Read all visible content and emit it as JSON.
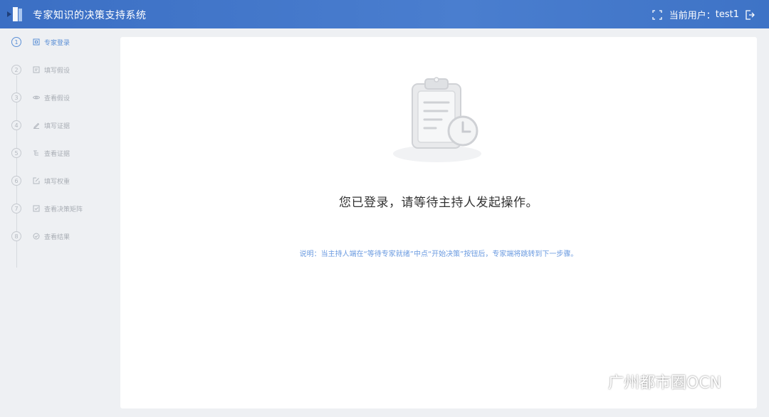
{
  "header": {
    "title": "专家知识的决策支持系统",
    "user_label": "当前用户：",
    "user_name": "test1"
  },
  "steps": [
    {
      "num": "1",
      "label": "专家登录",
      "icon": "login-icon",
      "active": true
    },
    {
      "num": "2",
      "label": "填写假设",
      "icon": "form-icon",
      "active": false
    },
    {
      "num": "3",
      "label": "查看假设",
      "icon": "eye-icon",
      "active": false
    },
    {
      "num": "4",
      "label": "填写证据",
      "icon": "pen-icon",
      "active": false
    },
    {
      "num": "5",
      "label": "查看证据",
      "icon": "list-icon",
      "active": false
    },
    {
      "num": "6",
      "label": "填写权重",
      "icon": "edit-icon",
      "active": false
    },
    {
      "num": "7",
      "label": "查看决策矩阵",
      "icon": "matrix-icon",
      "active": false
    },
    {
      "num": "8",
      "label": "查看结果",
      "icon": "check-circle-icon",
      "active": false
    }
  ],
  "main": {
    "message": "您已登录，请等待主持人发起操作。",
    "note": "说明：当主持人端在“等待专家就绪”中点“开始决策”按钮后，专家端将跳转到下一步骤。"
  },
  "watermark": {
    "text": "广州都市圈OCN"
  },
  "colors": {
    "header": "#3b6fc4",
    "accent": "#5b8fd6",
    "note": "#6b9be0"
  }
}
